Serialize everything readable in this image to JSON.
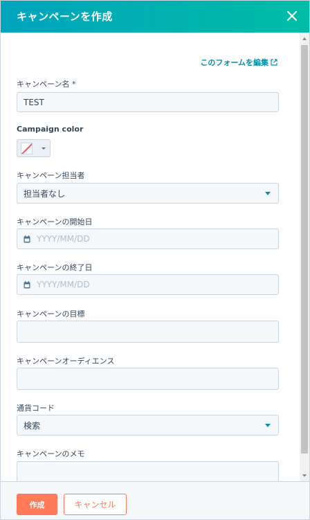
{
  "header": {
    "title": "キャンペーンを作成",
    "close_icon": "close-icon"
  },
  "form": {
    "edit_form_link": "このフォームを編集",
    "campaign_name": {
      "label": "キャンペーン名 *",
      "value": "TEST"
    },
    "campaign_color": {
      "label": "Campaign color",
      "swatch_color": "#f2545b"
    },
    "owner": {
      "label": "キャンペーン担当者",
      "value": "担当者なし"
    },
    "start_date": {
      "label": "キャンペーンの開始日",
      "placeholder": "YYYY/MM/DD"
    },
    "end_date": {
      "label": "キャンペーンの終了日",
      "placeholder": "YYYY/MM/DD"
    },
    "goal": {
      "label": "キャンペーンの目標",
      "value": ""
    },
    "audience": {
      "label": "キャンペーンオーディエンス",
      "value": ""
    },
    "currency": {
      "label": "通貨コード",
      "value": "検索"
    },
    "notes": {
      "label": "キャンペーンのメモ",
      "value": ""
    }
  },
  "footer": {
    "create_label": "作成",
    "cancel_label": "キャンセル"
  },
  "colors": {
    "header_gradient_start": "#00a4bd",
    "header_gradient_end": "#00bda5",
    "primary_button": "#ff7a59",
    "link": "#0091ae"
  }
}
